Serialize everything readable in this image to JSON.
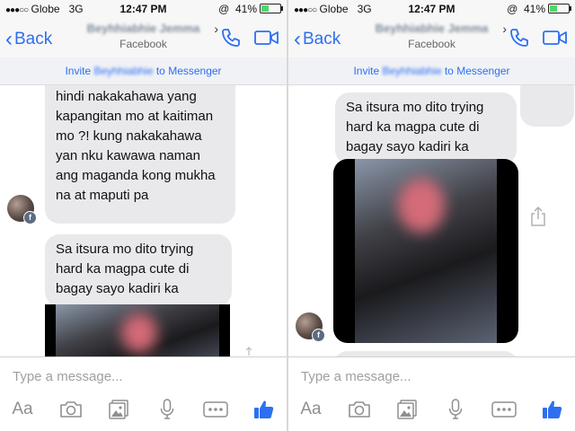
{
  "status": {
    "carrier": "Globe",
    "network": "3G",
    "time": "12:47 PM",
    "alarm_glyph": "@",
    "battery": "41%",
    "battery_level": 0.41
  },
  "header": {
    "back_label": "Back",
    "contact_name": "Beyhhiabhie Jemma",
    "subtitle": "Facebook"
  },
  "invite": {
    "prefix": "Invite ",
    "name": "Beyhhiabhie",
    "suffix": " to Messenger"
  },
  "messages": {
    "left_long": "hindi nakakahawa yang kapangitan mo at kaitiman mo ?! kung nakakahawa yan nku kawawa naman ang maganda kong mukha na at maputi pa",
    "photo_caption": "Sa itsura mo dito trying hard ka magpa cute di bagay sayo kadiri ka"
  },
  "composer": {
    "placeholder": "Type a message..."
  },
  "toolbar": {
    "aa_label": "Aa"
  },
  "colors": {
    "accent": "#2d6ff2",
    "bubble": "#e9e9eb",
    "invite_bg": "#f0f2f5"
  }
}
